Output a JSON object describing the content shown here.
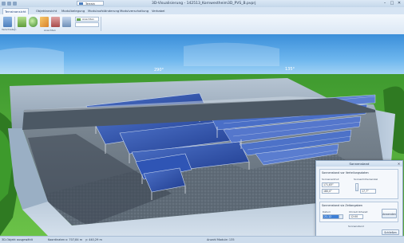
{
  "window": {
    "title": "3D-Visualisierung - 142513_Kornwestheim3D_PVS_B.pvprj",
    "combo_value": "Terrain",
    "controls": [
      "–",
      "□",
      "✕"
    ]
  },
  "tabs": [
    {
      "label": "Terrainansicht",
      "active": true
    },
    {
      "label": "Objektansicht",
      "active": false
    },
    {
      "label": "Modulbelegung",
      "active": false
    },
    {
      "label": "Modulaufständerung",
      "active": false
    },
    {
      "label": "Modulverschaltung",
      "active": false
    },
    {
      "label": "Verkabel",
      "active": false
    }
  ],
  "ribbon": {
    "first_button_label": "Verschieben",
    "small_button_label": "Ansichten",
    "group_label": "Ansichten"
  },
  "scene": {
    "compass_left": "290°",
    "compass_right": "135°"
  },
  "statusbar": {
    "item1": "3D-Objekt ausgewählt",
    "item2": "Koordinaten",
    "item3": "x: 707,84 m",
    "item4": "y: 440,29 m",
    "item5": "Anzahl Module: 135"
  },
  "sun_panel": {
    "title": "Sonnenstand",
    "group1_title": "Sonnenstand vor Verteilungsdaten",
    "azimuth_label": "Sonnenazimut",
    "elevation_label": "Sonnenhöhenwinkel",
    "azimuth_value": "180,0°",
    "elevation_value": "17,7°",
    "top_value": "171,83°",
    "group2_title": "Sonnenstand via Zeitangaben",
    "date_label": "Datum",
    "time_label": "Uhrzeit Ortszeit",
    "date_value": "21.12",
    "time_value": "12:00",
    "apply_button": "Anwenden",
    "bottom_label": "Sonnenstand",
    "close_button": "Schließen"
  }
}
